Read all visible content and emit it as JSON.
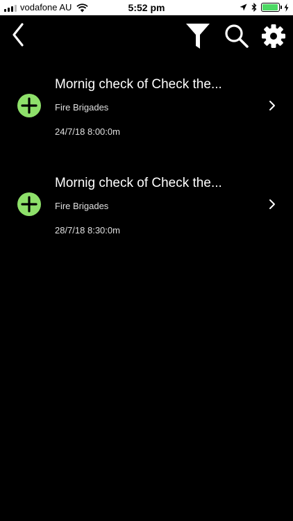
{
  "status_bar": {
    "carrier": "vodafone AU",
    "time": "5:52 pm",
    "battery_level": 0.95,
    "signal_bars": 3,
    "icons": [
      "signal-icon",
      "wifi-icon",
      "location-arrow-icon",
      "bluetooth-icon",
      "battery-icon",
      "charging-bolt-icon"
    ],
    "battery_color": "#4cd964"
  },
  "toolbar": {
    "icons": [
      "back-chevron-icon",
      "filter-icon",
      "search-icon",
      "gear-icon"
    ]
  },
  "items": [
    {
      "title": "Mornig check of Check the...",
      "subtitle": "Fire Brigades",
      "datetime": "24/7/18 8:00:0m",
      "icon": "add-circle-icon",
      "icon_color": "#8ee06a"
    },
    {
      "title": "Mornig check of Check the...",
      "subtitle": "Fire Brigades",
      "datetime": "28/7/18 8:30:0m",
      "icon": "add-circle-icon",
      "icon_color": "#8ee06a"
    }
  ]
}
